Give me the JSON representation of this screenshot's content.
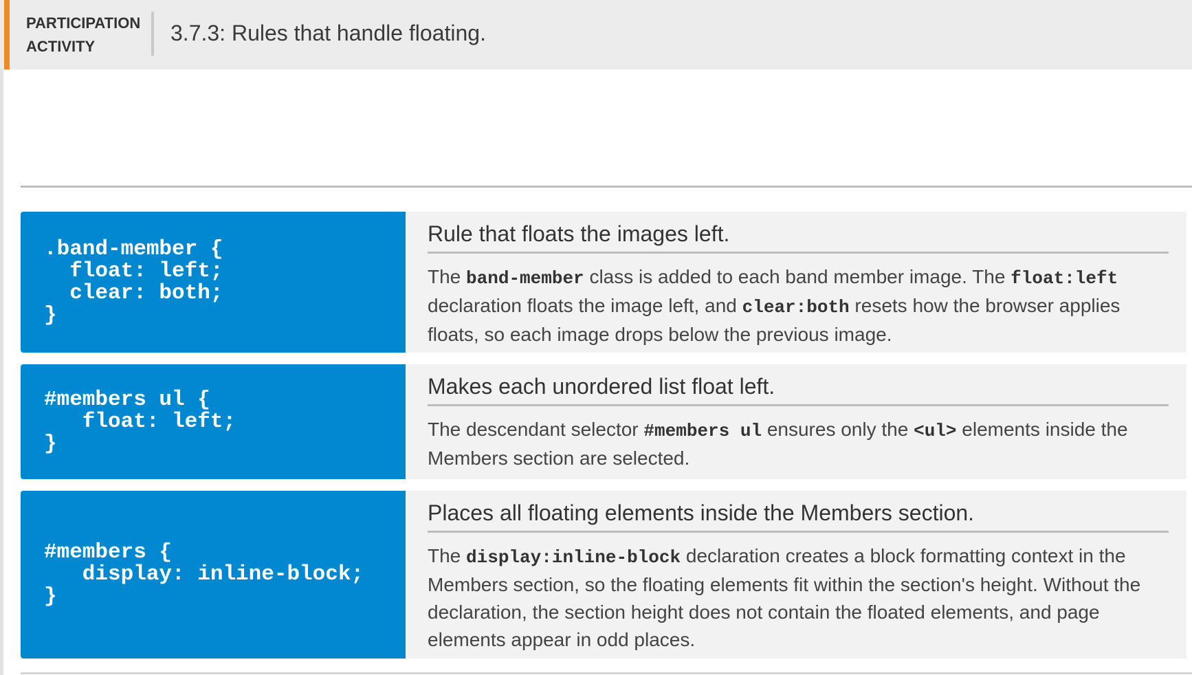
{
  "header": {
    "kind": "PARTICIPATION ACTIVITY",
    "title": "3.7.3: Rules that handle floating."
  },
  "rules": [
    {
      "code": ".band-member {\n  float: left;\n  clear: both;\n}",
      "heading": "Rule that floats the images left.",
      "body": [
        {
          "t": "The "
        },
        {
          "c": "band-member"
        },
        {
          "t": " class is added to each band member image. The "
        },
        {
          "c": "float:left"
        },
        {
          "t": " declaration floats the image left, and "
        },
        {
          "c": "clear:both"
        },
        {
          "t": " resets how the browser applies floats, so each image drops below the previous image."
        }
      ]
    },
    {
      "code": "#members ul {\n   float: left;\n}",
      "heading": "Makes each unordered list float left.",
      "body": [
        {
          "t": "The descendant selector "
        },
        {
          "c": "#members ul"
        },
        {
          "t": " ensures only the "
        },
        {
          "c": "<ul>"
        },
        {
          "t": " elements inside the Members section are selected."
        }
      ]
    },
    {
      "code": "#members {\n   display: inline-block;\n}",
      "heading": "Places all floating elements inside the Members section.",
      "body": [
        {
          "t": "The "
        },
        {
          "c": "display:inline-block"
        },
        {
          "t": " declaration creates a block formatting context in the Members section, so the floating elements fit within the section's height. Without the declaration, the section height does not contain the floated elements, and page elements appear in odd places."
        }
      ]
    }
  ]
}
